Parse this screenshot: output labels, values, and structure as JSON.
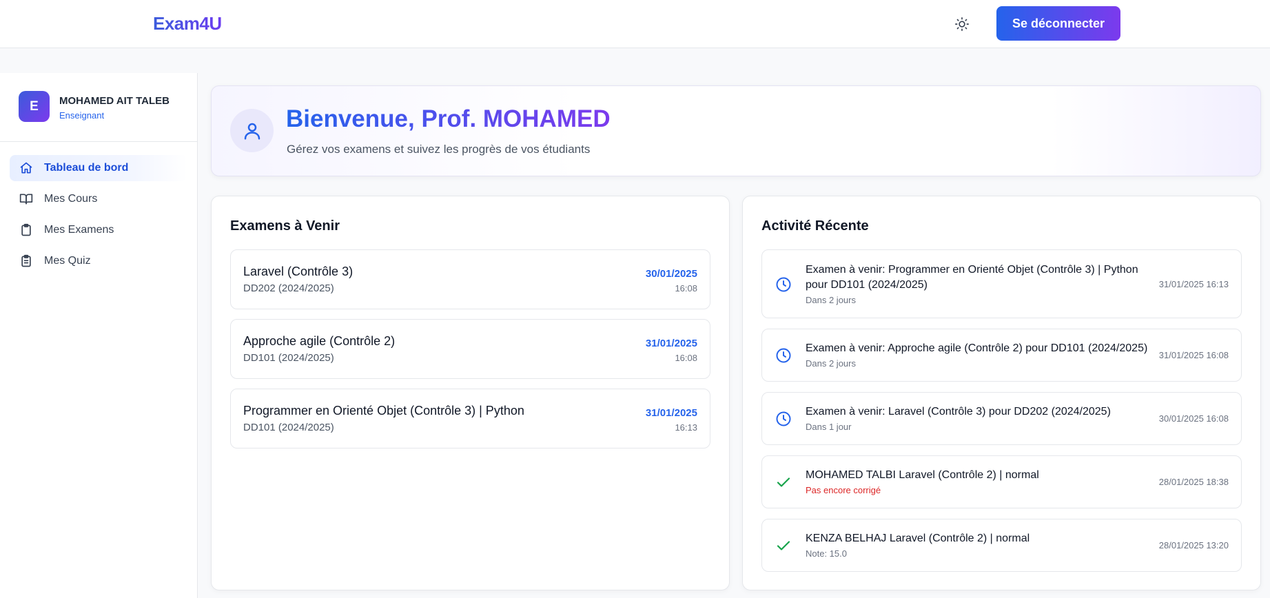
{
  "app": {
    "logo": "Exam4U"
  },
  "header": {
    "theme_icon": "sun-icon",
    "logout_label": "Se déconnecter"
  },
  "user": {
    "initial": "E",
    "name": "MOHAMED AIT TALEB",
    "role": "Enseignant"
  },
  "sidebar": {
    "items": [
      {
        "label": "Tableau de bord",
        "icon": "home-icon",
        "active": true
      },
      {
        "label": "Mes Cours",
        "icon": "book-icon",
        "active": false
      },
      {
        "label": "Mes Examens",
        "icon": "clipboard-icon",
        "active": false
      },
      {
        "label": "Mes Quiz",
        "icon": "clipboard-list-icon",
        "active": false
      }
    ]
  },
  "welcome": {
    "title": "Bienvenue, Prof. MOHAMED",
    "subtitle": "Gérez vos examens et suivez les progrès de vos étudiants",
    "icon": "user-icon"
  },
  "upcoming": {
    "title": "Examens à Venir",
    "items": [
      {
        "name": "Laravel (Contrôle 3)",
        "group": "DD202 (2024/2025)",
        "date": "30/01/2025",
        "time": "16:08"
      },
      {
        "name": "Approche agile (Contrôle 2)",
        "group": "DD101 (2024/2025)",
        "date": "31/01/2025",
        "time": "16:08"
      },
      {
        "name": "Programmer en Orienté Objet (Contrôle 3) | Python",
        "group": "DD101 (2024/2025)",
        "date": "31/01/2025",
        "time": "16:13"
      }
    ]
  },
  "activity": {
    "title": "Activité Récente",
    "items": [
      {
        "icon": "clock-icon",
        "text": "Examen à venir: Programmer en Orienté Objet (Contrôle 3) | Python pour DD101 (2024/2025)",
        "sub": "Dans 2 jours",
        "time": "31/01/2025 16:13"
      },
      {
        "icon": "clock-icon",
        "text": "Examen à venir: Approche agile (Contrôle 2) pour DD101 (2024/2025)",
        "sub": "Dans 2 jours",
        "time": "31/01/2025 16:08"
      },
      {
        "icon": "clock-icon",
        "text": "Examen à venir: Laravel (Contrôle 3) pour DD202 (2024/2025)",
        "sub": "Dans 1 jour",
        "time": "30/01/2025 16:08"
      },
      {
        "icon": "check-icon",
        "text": "MOHAMED TALBI Laravel (Contrôle 2) | normal",
        "sub": "Pas encore corrigé",
        "time": "28/01/2025 18:38"
      },
      {
        "icon": "check-icon",
        "text": "KENZA BELHAJ Laravel (Contrôle 2) | normal",
        "sub": "Note: 15.0",
        "time": "28/01/2025 13:20"
      }
    ]
  },
  "colors": {
    "primary": "#2563eb",
    "accent": "#7c3aed",
    "success": "#16a34a",
    "warning": "#dc2626"
  }
}
